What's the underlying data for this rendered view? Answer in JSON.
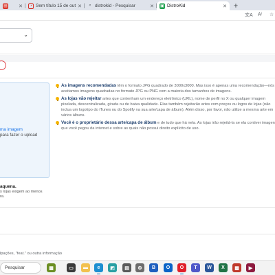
{
  "browser": {
    "tabs": [
      {
        "label": ""
      },
      {
        "label": "Sem título 15 de out. de 202"
      },
      {
        "label": "distrokid - Pesquisar"
      },
      {
        "label": "DistroKid"
      }
    ],
    "new_tab_label": "+"
  },
  "page": {
    "upload": {
      "link_text": "ma imagem",
      "sub_text": "para fazer o upload"
    },
    "requirements": {
      "bold_text": "aquena.",
      "line1": "s lojas exigem ao menos",
      "line2": "ra."
    },
    "tips": [
      {
        "lead": "As imagens recomendadas",
        "text": " têm o formato JPG quadrado de 3000x3000. Mas isso é apenas uma recomendação—nós aceitamos imagens quadradas no formato JPG ou PNG com a maioria dos tamanhos de imagens."
      },
      {
        "lead": "As lojas vão rejeitar",
        "text": " artes que contenham um endereço eletrônico (URL), nome de perfil no X ou qualquer imagem pixelada, descentralizada, girada ou de baixa qualidade. Elas também rejeitarão artes com preços ou logos de lojas (não inclua um logotipo do iTunes ou do Spotify na sua arte/capa de álbum). Além disso, por favor, não utilize a mesma arte em vários álbuns."
      },
      {
        "lead": "Você é o proprietário dessa arte/capa de álbum",
        "text": " e de tudo que há nela. As lojas irão rejeitá-la se ela contiver imagens que você pegou da internet e sobre as quais não possui direito explícito de uso."
      }
    ],
    "footer_text": "lpações, \"feat.\" ou outra informação"
  },
  "taskbar": {
    "search_placeholder": "Pesquisar"
  },
  "colors": {
    "tab_strip": "#dfe3eb",
    "accent_blue": "#1a73e8",
    "tip_lead": "#1d3f6e",
    "upload_bg": "#eef5fc",
    "warning_red": "#e0474c",
    "bulb_yellow": "#f5b400"
  }
}
